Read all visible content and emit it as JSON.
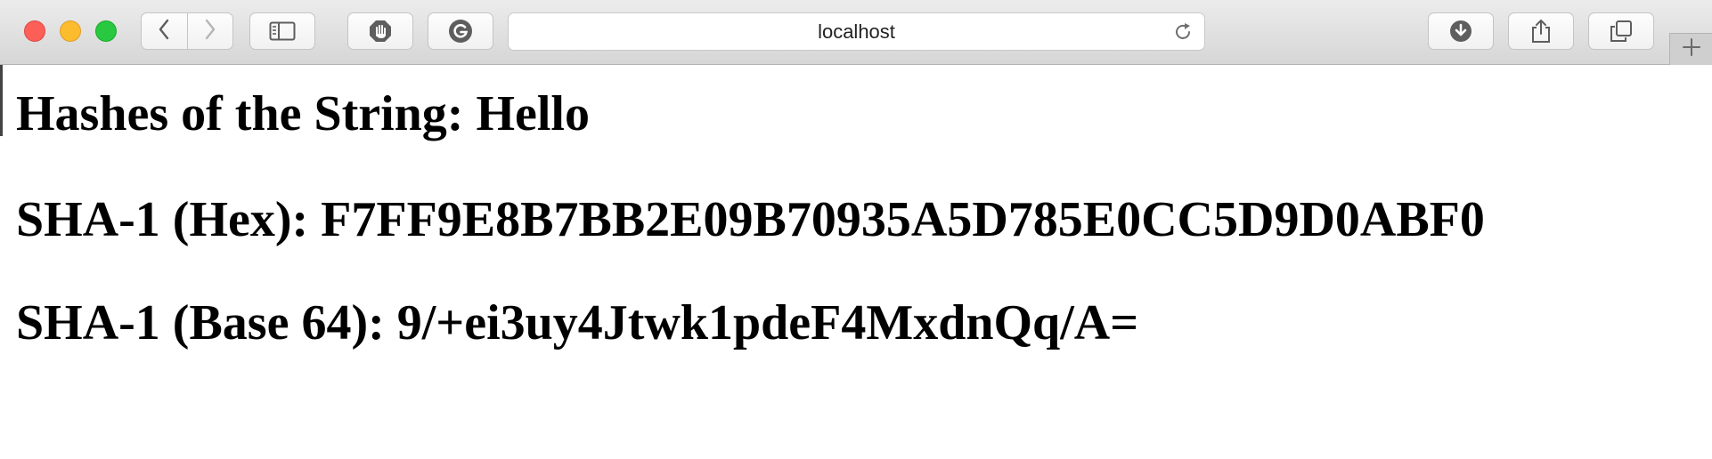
{
  "browser": {
    "address_bar": {
      "url": "localhost"
    },
    "icons": {
      "back": "chevron-left-icon",
      "forward": "chevron-right-icon",
      "sidebar": "sidebar-icon",
      "blocker": "hand-icon",
      "extension": "grammarly-icon",
      "reload": "reload-icon",
      "downloads": "download-icon",
      "share": "share-icon",
      "tabs": "tabs-overview-icon",
      "new_tab": "plus-icon"
    },
    "colors": {
      "close": "#fc5f57",
      "minimize": "#fdbc2e",
      "zoom": "#28c840"
    }
  },
  "page": {
    "title_heading": "Hashes of the String: Hello",
    "sha1_hex_line": "SHA-1 (Hex): F7FF9E8B7BB2E09B70935A5D785E0CC5D9D0ABF0",
    "sha1_base64_line": "SHA-1 (Base 64): 9/+ei3uy4Jtwk1pdeF4MxdnQq/A="
  }
}
